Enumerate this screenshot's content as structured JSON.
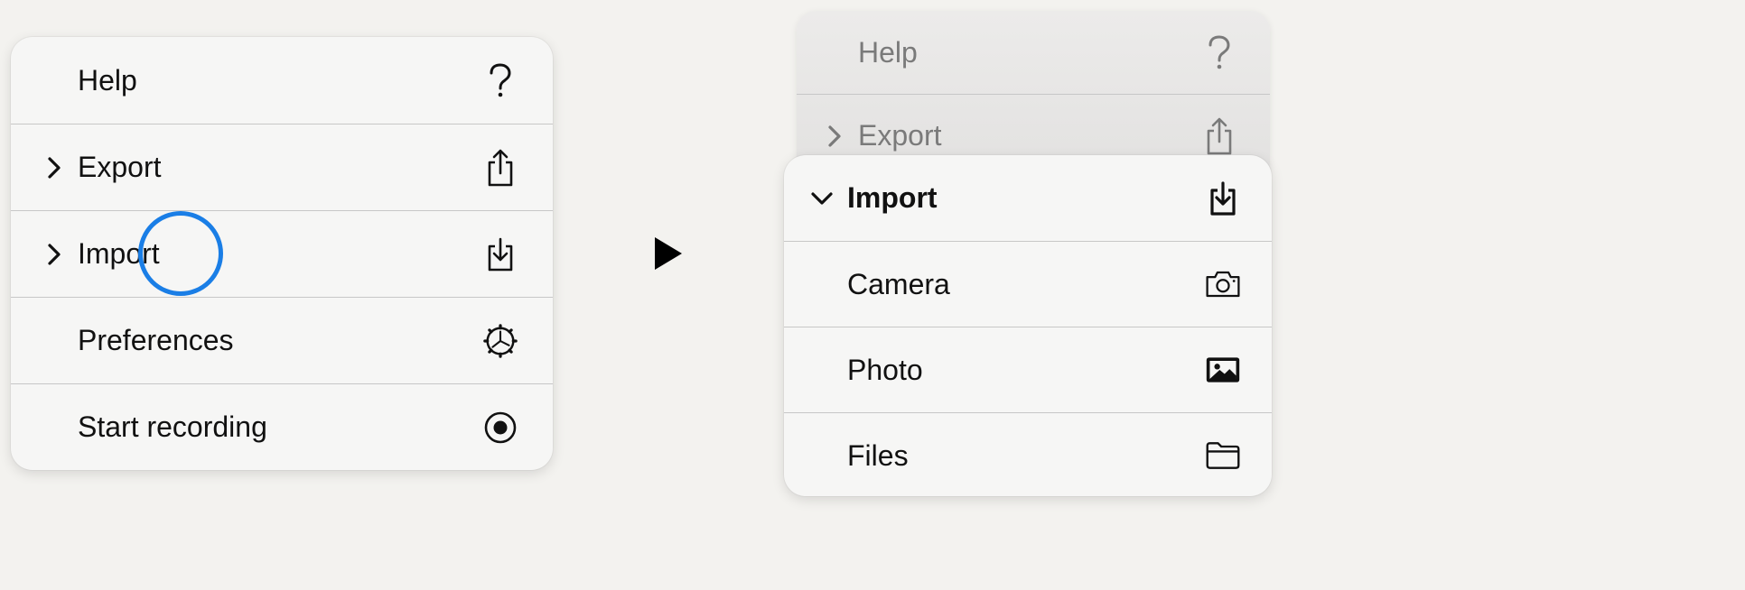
{
  "left_menu": {
    "items": [
      {
        "label": "Help",
        "icon": "question-mark-icon",
        "has_chevron": false
      },
      {
        "label": "Export",
        "icon": "share-icon",
        "has_chevron": true
      },
      {
        "label": "Import",
        "icon": "import-icon",
        "has_chevron": true
      },
      {
        "label": "Preferences",
        "icon": "gear-icon",
        "has_chevron": false
      },
      {
        "label": "Start recording",
        "icon": "record-icon",
        "has_chevron": false
      }
    ]
  },
  "right_menu": {
    "background_items": [
      {
        "label": "Help",
        "icon": "question-mark-icon"
      },
      {
        "label": "Export",
        "icon": "share-icon"
      }
    ],
    "submenu": {
      "header": {
        "label": "Import",
        "icon": "import-icon"
      },
      "items": [
        {
          "label": "Camera",
          "icon": "camera-icon"
        },
        {
          "label": "Photo",
          "icon": "photo-icon"
        },
        {
          "label": "Files",
          "icon": "folder-icon"
        }
      ]
    }
  },
  "colors": {
    "background": "#f3f2ef",
    "menu_background": "#f6f6f5",
    "tap_indicator": "#1a7ee6",
    "divider": "#c7c7c7"
  }
}
